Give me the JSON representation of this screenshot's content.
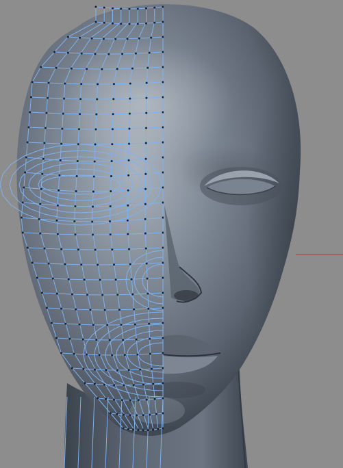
{
  "viewport": {
    "background_color": "#8d8d8d",
    "wireframe_color": "#7fb2ee",
    "vertex_color": "#1a2230",
    "axis_color": "#b04a4a",
    "skin_color": "#67717d",
    "shadow_color": "#39414b",
    "highlight_color": "#b4bcc4"
  },
  "scene": {
    "object_name": "head-mesh",
    "left_half_display": "wireframe-on-shaded",
    "right_half_display": "smooth-shaded",
    "axis_line": "x-axis-line"
  }
}
